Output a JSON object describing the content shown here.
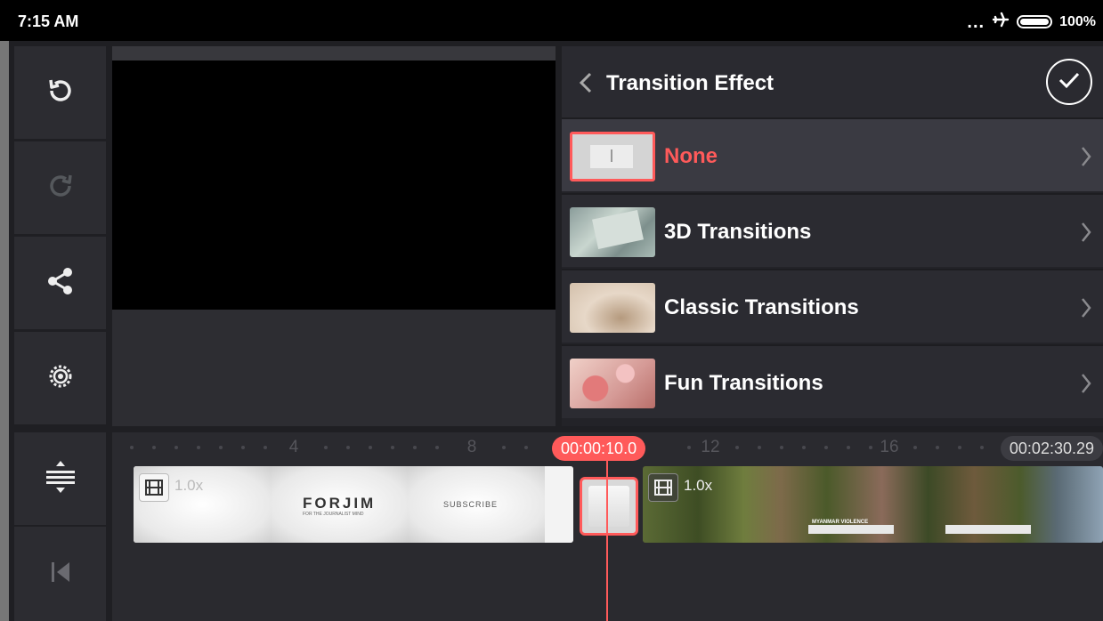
{
  "status_bar": {
    "time": "7:15 AM",
    "battery": "100%"
  },
  "panel": {
    "title": "Transition Effect",
    "rows": [
      {
        "label": "None",
        "selected": true
      },
      {
        "label": "3D Transitions",
        "selected": false
      },
      {
        "label": "Classic Transitions",
        "selected": false
      },
      {
        "label": "Fun Transitions",
        "selected": false
      }
    ]
  },
  "timeline": {
    "ruler_numbers": [
      "4",
      "8",
      "12",
      "16"
    ],
    "current_time": "00:00:10.0",
    "duration": "00:02:30.29",
    "clip1": {
      "speed": "1.0x",
      "logo": "FORJIM",
      "logo_sub": "FOR THE JOURNALIST MIND",
      "subscribe": "SUBSCRIBE"
    },
    "clip2": {
      "speed": "1.0x",
      "caption": "MYANMAR VIOLENCE"
    }
  },
  "colors": {
    "accent": "#ff5a5a",
    "panel_bg": "#232328",
    "rail_bg": "#2c2c31"
  }
}
